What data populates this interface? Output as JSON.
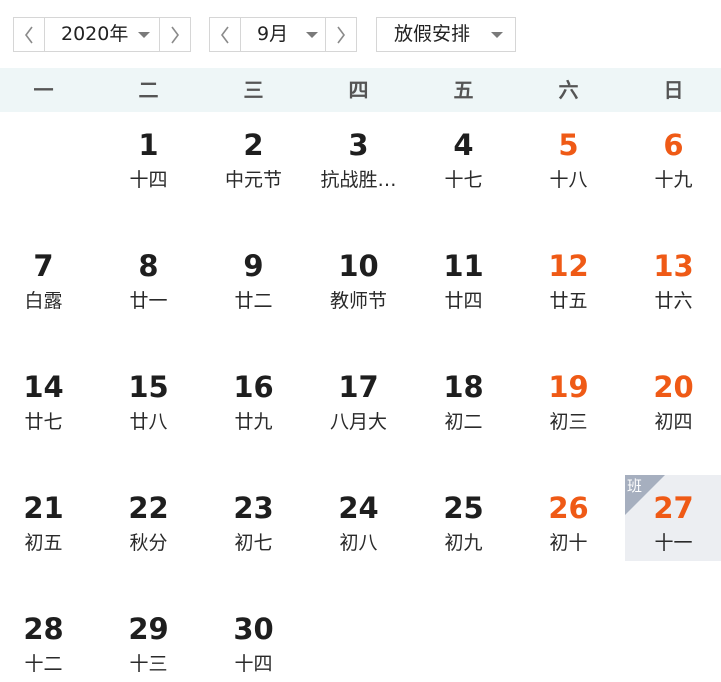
{
  "toolbar": {
    "year_label": "2020年",
    "month_label": "9月",
    "holiday_label": "放假安排"
  },
  "weekdays": [
    "一",
    "二",
    "三",
    "四",
    "五",
    "六",
    "日"
  ],
  "colors": {
    "weekend": "#ef5a16",
    "header_bg": "#eef6f7",
    "work_day_bg": "#eceef2"
  },
  "weeks": [
    [
      {
        "day": "",
        "lunar": ""
      },
      {
        "day": "1",
        "lunar": "十四"
      },
      {
        "day": "2",
        "lunar": "中元节"
      },
      {
        "day": "3",
        "lunar": "抗战胜…"
      },
      {
        "day": "4",
        "lunar": "十七"
      },
      {
        "day": "5",
        "lunar": "十八",
        "weekend": true
      },
      {
        "day": "6",
        "lunar": "十九",
        "weekend": true
      }
    ],
    [
      {
        "day": "7",
        "lunar": "白露"
      },
      {
        "day": "8",
        "lunar": "廿一"
      },
      {
        "day": "9",
        "lunar": "廿二"
      },
      {
        "day": "10",
        "lunar": "教师节"
      },
      {
        "day": "11",
        "lunar": "廿四"
      },
      {
        "day": "12",
        "lunar": "廿五",
        "weekend": true
      },
      {
        "day": "13",
        "lunar": "廿六",
        "weekend": true
      }
    ],
    [
      {
        "day": "14",
        "lunar": "廿七"
      },
      {
        "day": "15",
        "lunar": "廿八"
      },
      {
        "day": "16",
        "lunar": "廿九"
      },
      {
        "day": "17",
        "lunar": "八月大"
      },
      {
        "day": "18",
        "lunar": "初二"
      },
      {
        "day": "19",
        "lunar": "初三",
        "weekend": true
      },
      {
        "day": "20",
        "lunar": "初四",
        "weekend": true
      }
    ],
    [
      {
        "day": "21",
        "lunar": "初五"
      },
      {
        "day": "22",
        "lunar": "秋分"
      },
      {
        "day": "23",
        "lunar": "初七"
      },
      {
        "day": "24",
        "lunar": "初八"
      },
      {
        "day": "25",
        "lunar": "初九"
      },
      {
        "day": "26",
        "lunar": "初十",
        "weekend": true
      },
      {
        "day": "27",
        "lunar": "十一",
        "weekend": true,
        "badge": "班"
      }
    ],
    [
      {
        "day": "28",
        "lunar": "十二"
      },
      {
        "day": "29",
        "lunar": "十三"
      },
      {
        "day": "30",
        "lunar": "十四"
      },
      {
        "day": "",
        "lunar": ""
      },
      {
        "day": "",
        "lunar": ""
      },
      {
        "day": "",
        "lunar": ""
      },
      {
        "day": "",
        "lunar": ""
      }
    ]
  ]
}
